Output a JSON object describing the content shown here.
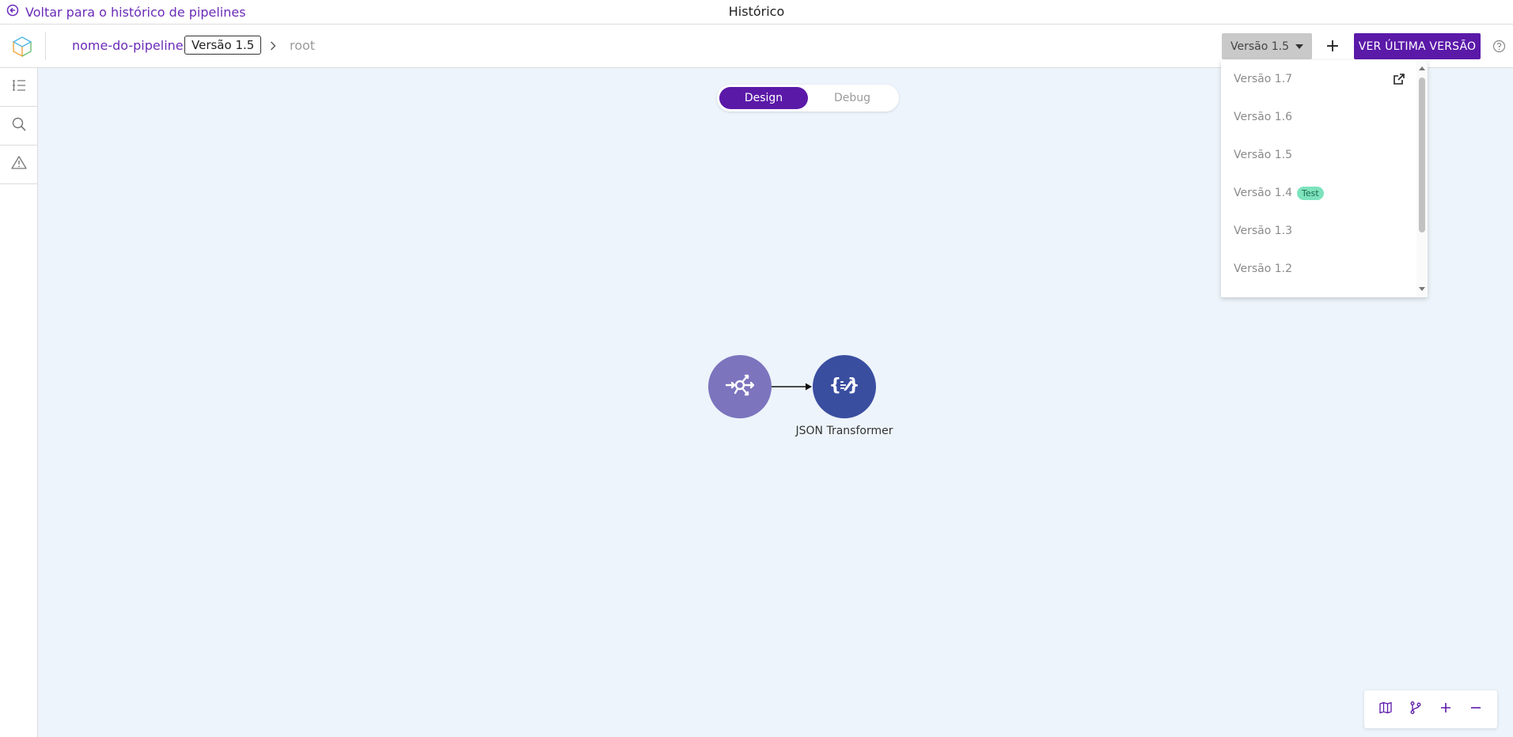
{
  "topbar": {
    "back_label": "Voltar para o histórico de pipelines",
    "title": "Histórico"
  },
  "header": {
    "pipeline_name": "nome-do-pipeline",
    "version_chip": "Versão 1.5",
    "breadcrumb_root": "root",
    "version_select_label": "Versão 1.5",
    "add_label": "+",
    "latest_button_label": "VER ÚLTIMA VERSÃO"
  },
  "sidebar": {
    "items": [
      {
        "name": "list-icon"
      },
      {
        "name": "search-icon"
      },
      {
        "name": "warning-icon"
      }
    ]
  },
  "canvas": {
    "modes": [
      "Design",
      "Debug"
    ],
    "active_mode": "Design",
    "nodes": [
      {
        "icon": "event-hub-icon",
        "label": ""
      },
      {
        "icon": "json-transformer-icon",
        "label": "JSON Transformer"
      }
    ],
    "zoom_controls": [
      "map-icon",
      "branch-icon",
      "zoom-in-icon",
      "zoom-out-icon"
    ]
  },
  "version_dropdown": {
    "items": [
      {
        "label": "Versão 1.7",
        "badge": "",
        "external": true
      },
      {
        "label": "Versão 1.6",
        "badge": "",
        "external": false
      },
      {
        "label": "Versão 1.5",
        "badge": "",
        "external": false
      },
      {
        "label": "Versão 1.4",
        "badge": "Test",
        "external": false
      },
      {
        "label": "Versão 1.3",
        "badge": "",
        "external": false
      },
      {
        "label": "Versão 1.2",
        "badge": "",
        "external": false
      }
    ]
  },
  "colors": {
    "accent": "#5b19a8",
    "link": "#6a2bb8",
    "canvas_bg": "#edf4fb",
    "node_a": "#7c74bd",
    "node_b": "#3a4ea0",
    "badge_bg": "#7de3bd"
  }
}
